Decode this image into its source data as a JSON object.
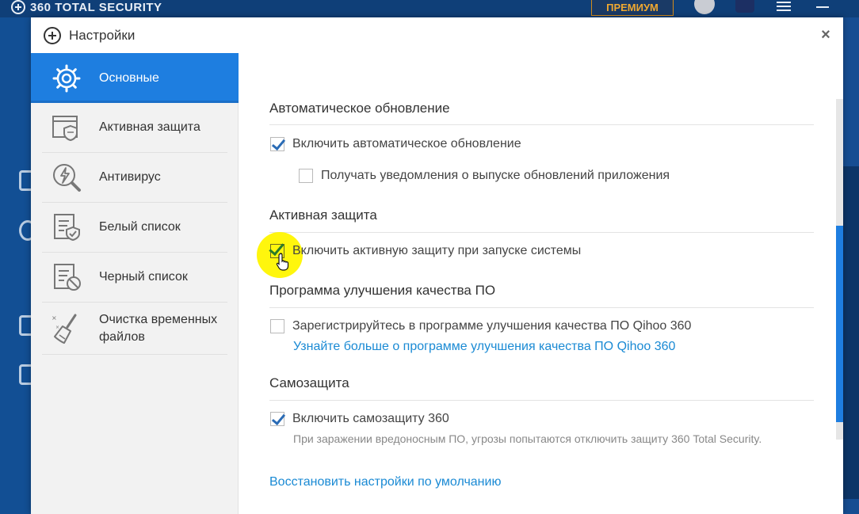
{
  "background_app": {
    "title": "360 TOTAL SECURITY",
    "premium_label": "ПРЕМИУМ"
  },
  "dialog": {
    "title": "Настройки",
    "close_symbol": "×"
  },
  "nav": {
    "items": [
      {
        "label": "Основные",
        "icon": "gear-icon",
        "active": true
      },
      {
        "label": "Активная защита",
        "icon": "shield-window-icon",
        "active": false
      },
      {
        "label": "Антивирус",
        "icon": "lightning-magnifier-icon",
        "active": false
      },
      {
        "label": "Белый список",
        "icon": "whitelist-icon",
        "active": false
      },
      {
        "label": "Черный список",
        "icon": "blacklist-icon",
        "active": false
      },
      {
        "label": "Очистка временных файлов",
        "icon": "broom-icon",
        "active": false
      }
    ]
  },
  "sections": {
    "auto_update": {
      "title": "Автоматическое обновление",
      "opt_enable": {
        "label": "Включить автоматическое обновление",
        "checked": true
      },
      "opt_notify": {
        "label": "Получать уведомления о выпуске обновлений приложения",
        "checked": false
      }
    },
    "active_protection": {
      "title": "Активная защита",
      "opt_enable": {
        "label": "Включить активную защиту при запуске системы",
        "checked": true
      }
    },
    "quality_program": {
      "title": "Программа улучшения качества ПО",
      "opt_register": {
        "label": "Зарегистрируйтесь в программе улучшения качества ПО Qihoo 360",
        "checked": false
      },
      "learn_more": "Узнайте больше о программе улучшения качества ПО Qihoo 360"
    },
    "self_protection": {
      "title": "Самозащита",
      "opt_enable": {
        "label": "Включить самозащиту 360",
        "checked": true
      },
      "description": "При заражении вредоносным ПО, угрозы попытаются отключить защиту 360 Total Security."
    }
  },
  "restore_defaults": "Восстановить настройки по умолчанию",
  "colors": {
    "accent": "#1e7ee0",
    "link": "#1a8ad4",
    "highlight": "#fff500"
  }
}
